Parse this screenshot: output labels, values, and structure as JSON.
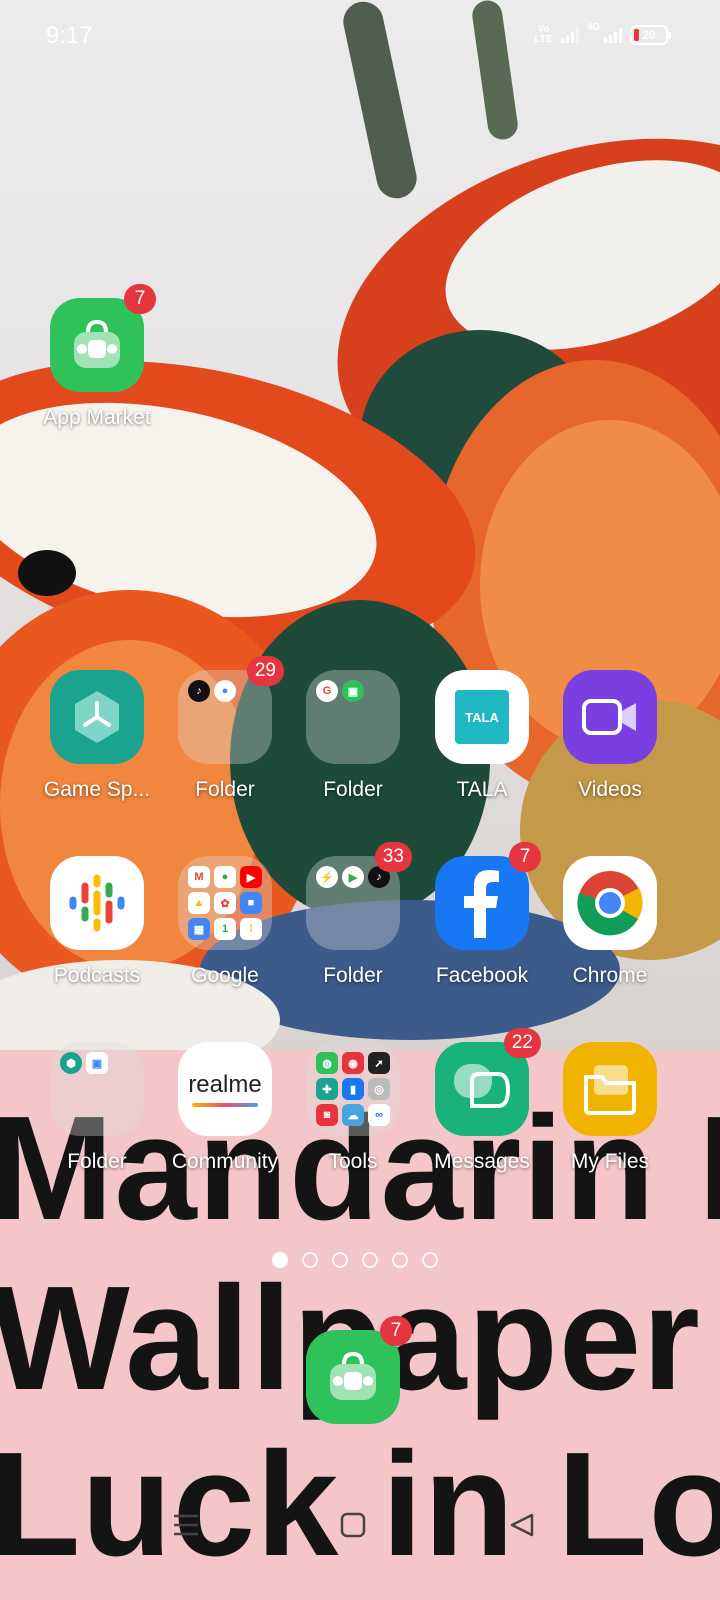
{
  "status_bar": {
    "time": "9:17",
    "volte_label_1": "Vo",
    "volte_label_2": "LTE",
    "network": "4G",
    "battery": "20"
  },
  "wallpaper": {
    "line1": "Mandarin Du",
    "line2": "Wallpaper f",
    "line3": "Luck in Lov"
  },
  "apps": {
    "app_market": {
      "label": "App Market",
      "badge": "7",
      "color": "#2fc25b"
    },
    "game_space": {
      "label": "Game Sp...",
      "color": "#1aa38f"
    },
    "folder_1": {
      "label": "Folder",
      "badge": "29"
    },
    "folder_2": {
      "label": "Folder"
    },
    "tala": {
      "label": "TALA",
      "icon_text": "TALA",
      "color": "#1fb8c3"
    },
    "videos": {
      "label": "Videos",
      "color": "#7a3fe0"
    },
    "podcasts": {
      "label": "Podcasts"
    },
    "google": {
      "label": "Google"
    },
    "folder_3": {
      "label": "Folder",
      "badge": "33"
    },
    "facebook": {
      "label": "Facebook",
      "badge": "7",
      "color": "#1877f2"
    },
    "chrome": {
      "label": "Chrome"
    },
    "folder_4": {
      "label": "Folder"
    },
    "community": {
      "label": "Community",
      "icon_text": "realme"
    },
    "tools": {
      "label": "Tools"
    },
    "messages": {
      "label": "Messages",
      "badge": "22",
      "color": "#18b27a"
    },
    "my_files": {
      "label": "My Files",
      "color": "#f0b400"
    }
  },
  "dock": {
    "app_market": {
      "badge": "7"
    }
  },
  "page_indicator": {
    "pages": 6,
    "active": 1
  }
}
